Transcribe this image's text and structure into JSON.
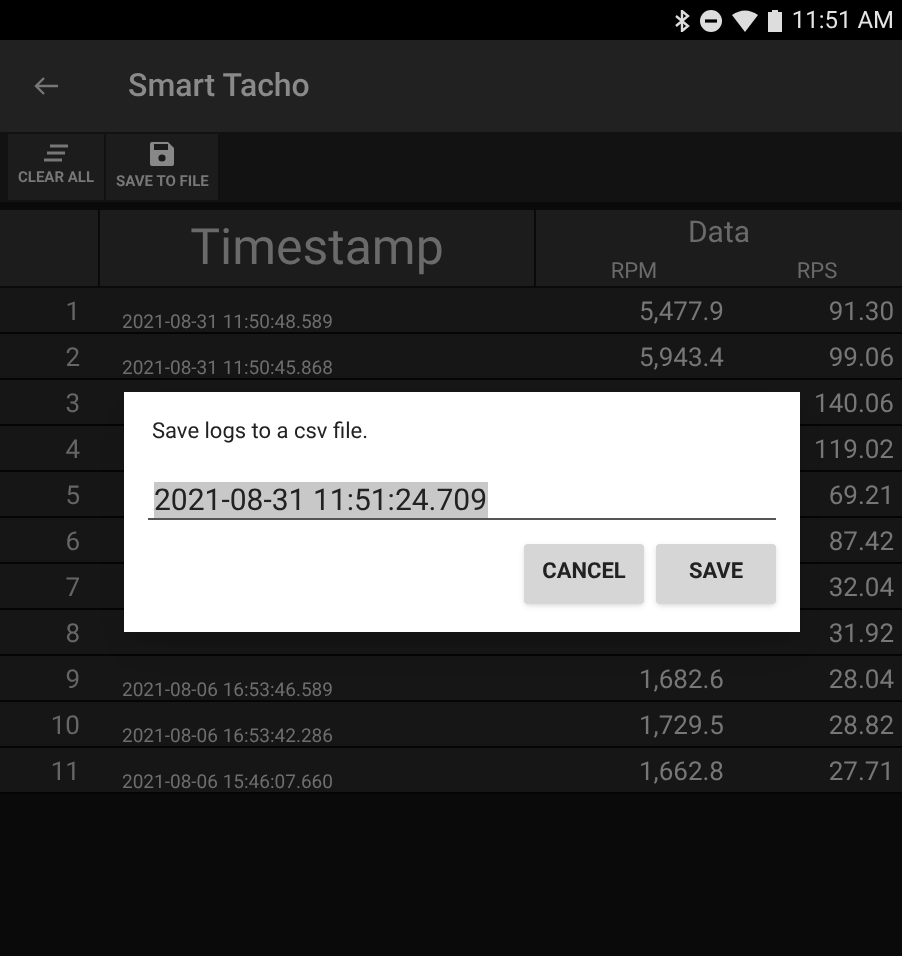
{
  "status_bar": {
    "time": "11:51 AM"
  },
  "app_bar": {
    "title": "Smart Tacho"
  },
  "toolbar": [
    {
      "kind": "clear",
      "label": "CLEAR ALL"
    },
    {
      "kind": "save",
      "label": "SAVE TO FILE"
    }
  ],
  "table": {
    "columns": {
      "timestamp": "Timestamp",
      "data": "Data",
      "rpm": "RPM",
      "rps": "RPS"
    },
    "rows": [
      {
        "index": "1",
        "timestamp": "2021-08-31 11:50:48.589",
        "rpm": "5,477.9",
        "rps": "91.30"
      },
      {
        "index": "2",
        "timestamp": "2021-08-31 11:50:45.868",
        "rpm": "5,943.4",
        "rps": "99.06"
      },
      {
        "index": "3",
        "rps": "140.06"
      },
      {
        "index": "4",
        "rps": "119.02"
      },
      {
        "index": "5",
        "rps": "69.21"
      },
      {
        "index": "6",
        "rps": "87.42"
      },
      {
        "index": "7",
        "rps": "32.04"
      },
      {
        "index": "8",
        "rps": "31.92"
      },
      {
        "index": "9",
        "timestamp": "2021-08-06 16:53:46.589",
        "rpm": "1,682.6",
        "rps": "28.04"
      },
      {
        "index": "10",
        "timestamp": "2021-08-06 16:53:42.286",
        "rpm": "1,729.5",
        "rps": "28.82"
      },
      {
        "index": "11",
        "timestamp": "2021-08-06 15:46:07.660",
        "rpm": "1,662.8",
        "rps": "27.71"
      }
    ]
  },
  "dialog": {
    "message": "Save logs to a csv file.",
    "value": "2021-08-31 11:51:24.709",
    "buttons": [
      "CANCEL",
      "SAVE"
    ]
  }
}
